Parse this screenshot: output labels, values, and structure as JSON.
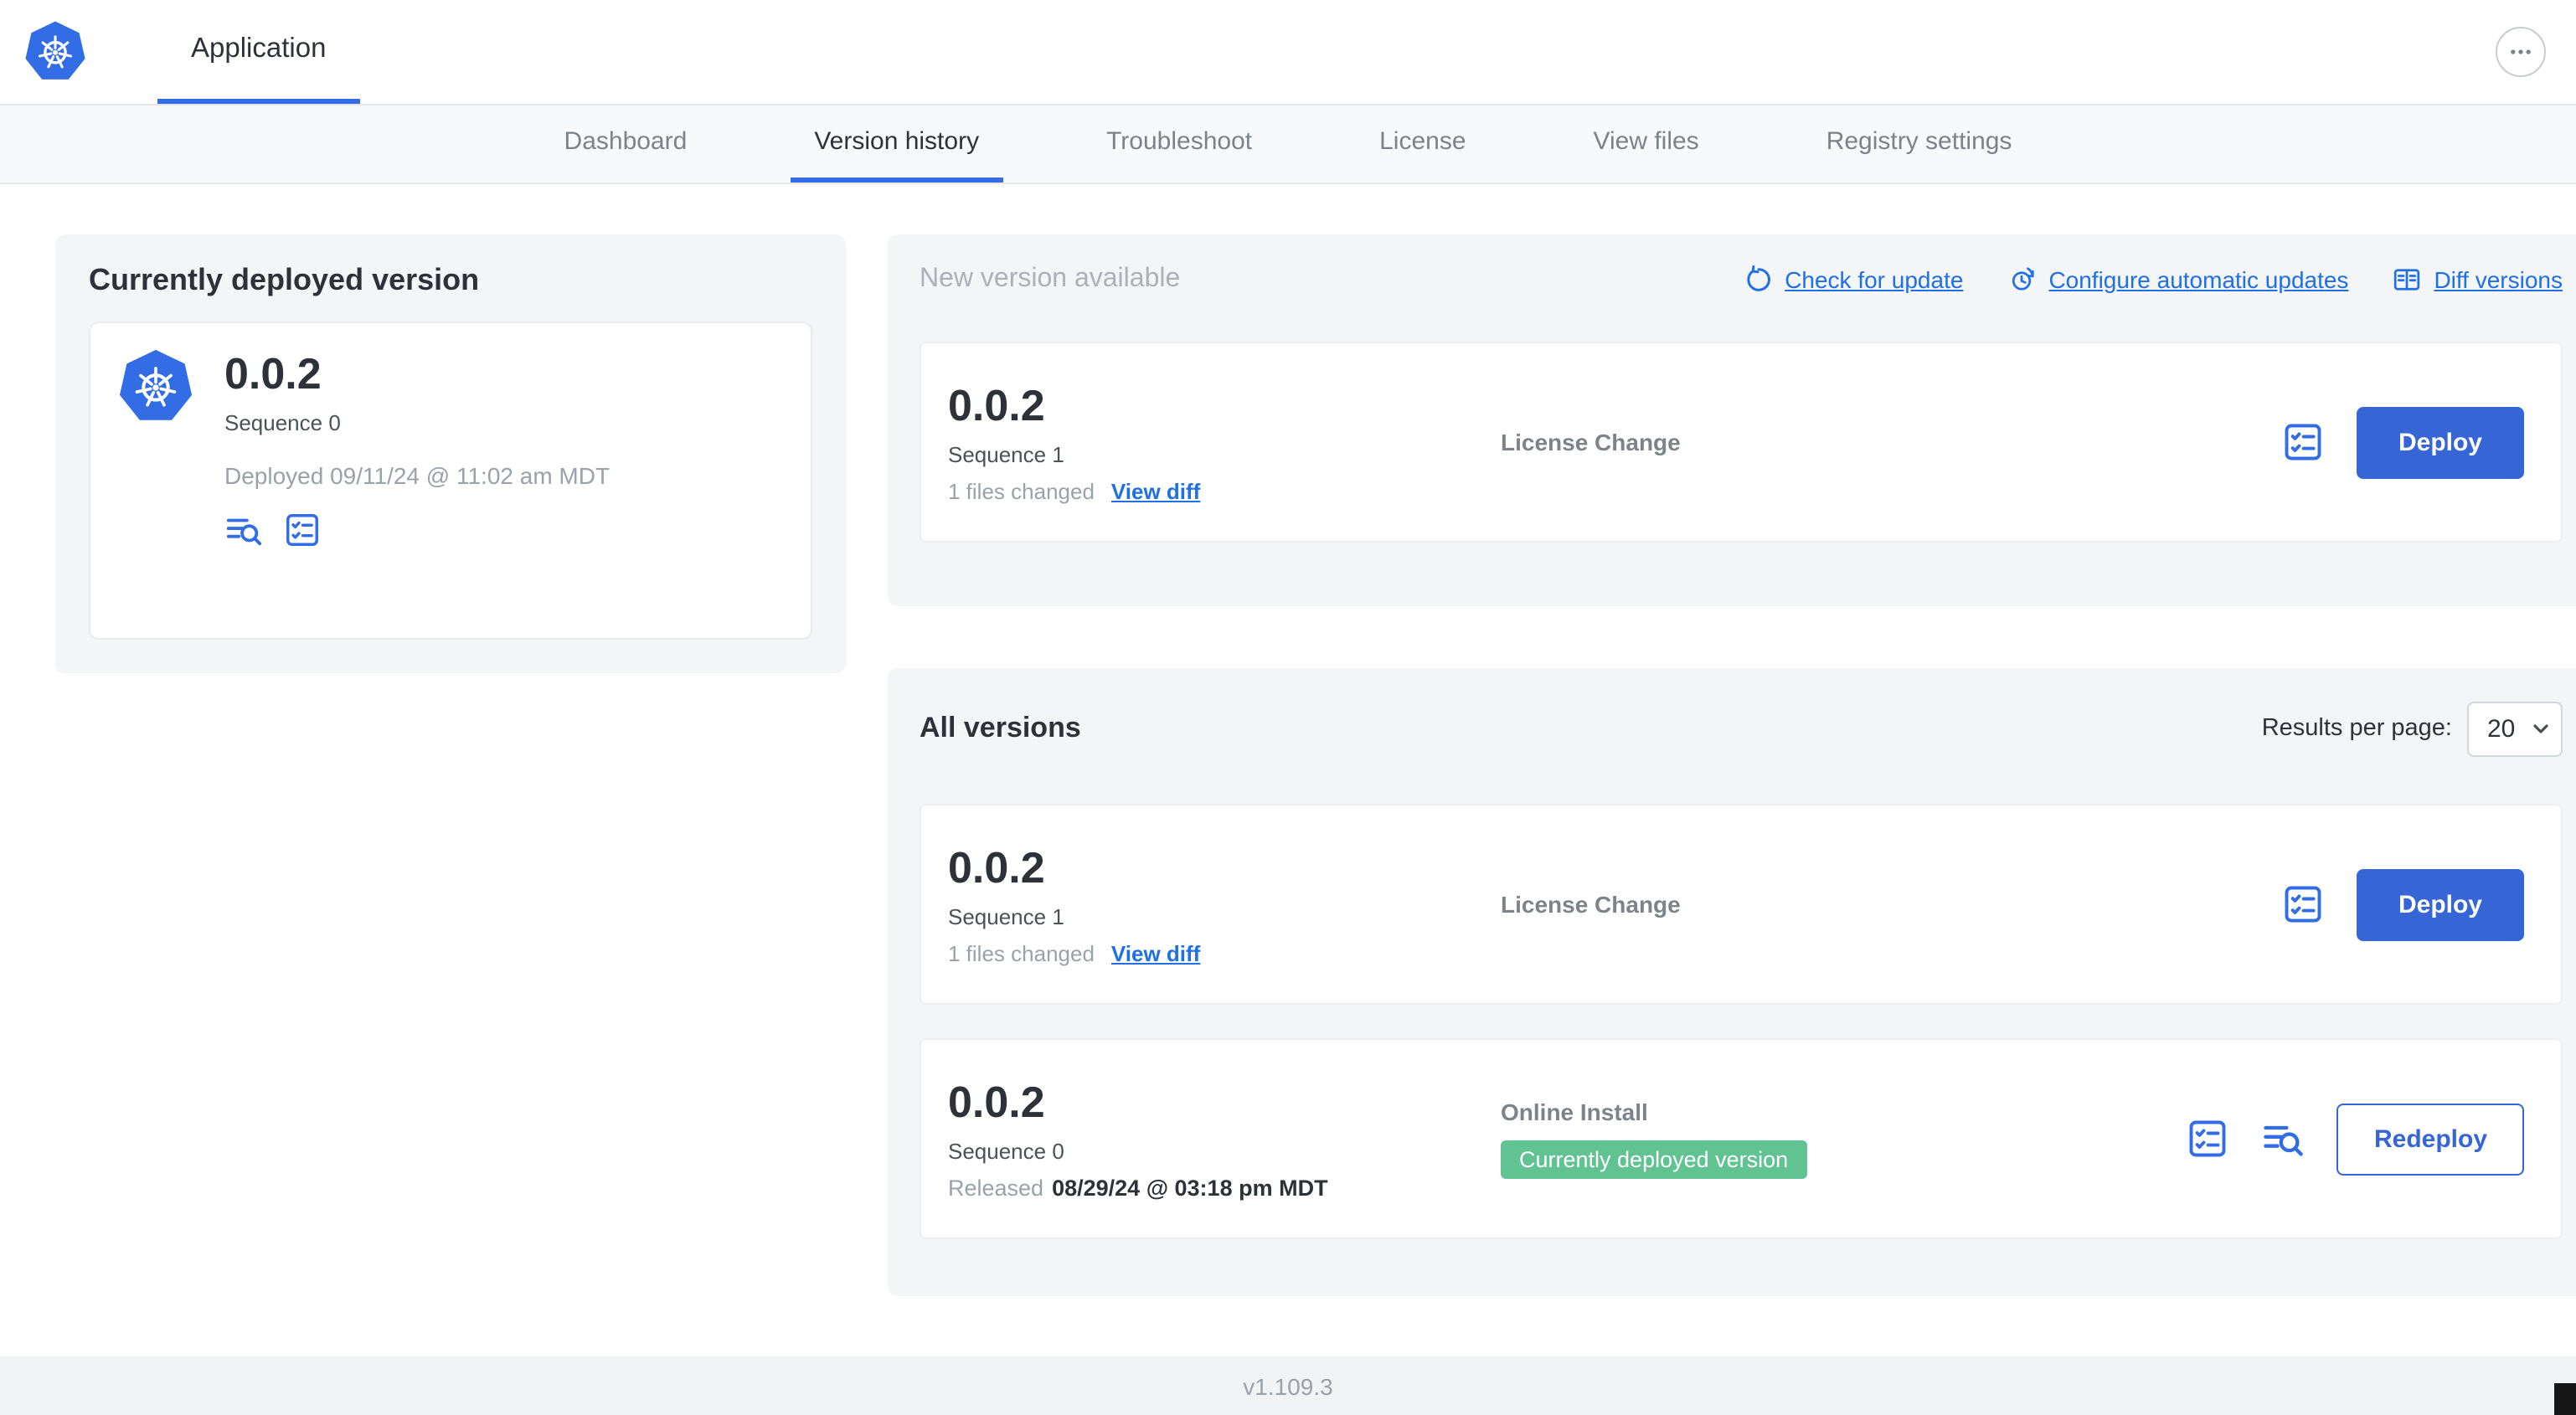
{
  "colors": {
    "accent_blue": "#326DE6",
    "button_blue": "#3666D6",
    "link_blue": "#1F6FE5",
    "badge_green": "#62C392",
    "panel_gray": "#F4F5F7"
  },
  "header": {
    "app_name": "Application"
  },
  "nav": {
    "tabs": [
      {
        "label": "Dashboard",
        "active": false
      },
      {
        "label": "Version history",
        "active": true
      },
      {
        "label": "Troubleshoot",
        "active": false
      },
      {
        "label": "License",
        "active": false
      },
      {
        "label": "View files",
        "active": false
      },
      {
        "label": "Registry settings",
        "active": false
      }
    ]
  },
  "current_version": {
    "title": "Currently deployed version",
    "version": "0.0.2",
    "sequence": "Sequence 0",
    "deployed": "Deployed 09/11/24 @ 11:02 am MDT"
  },
  "new_version": {
    "title": "New version available",
    "check_for_update": "Check for update",
    "configure_updates": "Configure automatic updates",
    "diff_versions": "Diff versions",
    "card": {
      "version": "0.0.2",
      "sequence": "Sequence 1",
      "files_changed": "1 files changed",
      "view_diff": "View diff",
      "source": "License Change",
      "action": "Deploy"
    }
  },
  "all_versions": {
    "title": "All versions",
    "results_per_page_label": "Results per page:",
    "results_per_page_value": "20",
    "rows": [
      {
        "version": "0.0.2",
        "sequence": "Sequence 1",
        "files_changed": "1 files changed",
        "view_diff": "View diff",
        "source": "License Change",
        "action": "Deploy"
      },
      {
        "version": "0.0.2",
        "sequence": "Sequence 0",
        "released_prefix": "Released",
        "released_date": "08/29/24 @ 03:18 pm MDT",
        "source": "Online Install",
        "badge": "Currently deployed version",
        "action": "Redeploy"
      }
    ]
  },
  "footer": {
    "app_version": "v1.109.3"
  }
}
